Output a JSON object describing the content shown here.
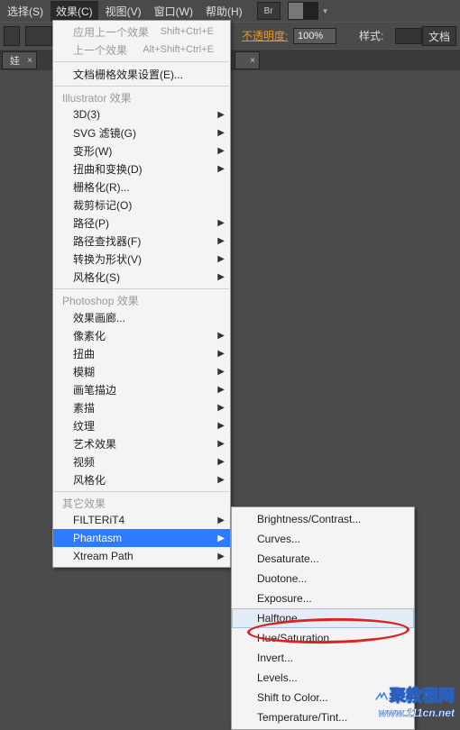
{
  "menubar": {
    "items": [
      "选择(S)",
      "效果(C)",
      "视图(V)",
      "窗口(W)",
      "帮助(H)"
    ],
    "br_label": "Br"
  },
  "optionbar": {
    "opacity_label": "不透明度:",
    "opacity_value": "100%",
    "style_label": "样式:",
    "right_button": "文档"
  },
  "tabs": {
    "t1_label": "娃",
    "t2_label": ""
  },
  "dropdown": {
    "apply_last": "应用上一个效果",
    "apply_last_sc": "Shift+Ctrl+E",
    "last": "上一个效果",
    "last_sc": "Alt+Shift+Ctrl+E",
    "doc_raster": "文档栅格效果设置(E)...",
    "section_ai": "Illustrator 效果",
    "ai": {
      "threeD": "3D(3)",
      "svg": "SVG 滤镜(G)",
      "warp": "变形(W)",
      "distort": "扭曲和变换(D)",
      "rasterize": "栅格化(R)...",
      "crop": "裁剪标记(O)",
      "path": "路径(P)",
      "pathfinder": "路径查找器(F)",
      "convert": "转换为形状(V)",
      "stylize": "风格化(S)"
    },
    "section_ps": "Photoshop 效果",
    "ps": {
      "gallery": "效果画廊...",
      "pixelate": "像素化",
      "distort": "扭曲",
      "blur": "模糊",
      "brush": "画笔描边",
      "sketch": "素描",
      "texture": "纹理",
      "artistic": "艺术效果",
      "video": "视频",
      "stylize": "风格化"
    },
    "section_other": "其它效果",
    "other": {
      "filterit": "FILTERiT4",
      "phantasm": "Phantasm",
      "xtream": "Xtream Path"
    }
  },
  "submenu": {
    "items": [
      "Brightness/Contrast...",
      "Curves...",
      "Desaturate...",
      "Duotone...",
      "Exposure...",
      "Halftone...",
      "Hue/Saturation...",
      "Invert...",
      "Levels...",
      "Shift to Color...",
      "Temperature/Tint..."
    ],
    "hover_index": 5
  },
  "watermark": {
    "line1": "聚教程网",
    "line2": "www.111cn.net"
  }
}
